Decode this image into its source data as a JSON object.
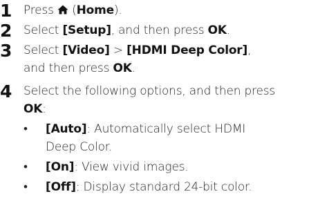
{
  "steps": [
    {
      "number": "1",
      "segments": [
        "Press ",
        " (",
        "Home",
        ")."
      ],
      "icon": "home-icon"
    },
    {
      "number": "2",
      "segments": [
        "Select ",
        "[Setup]",
        ", and then press ",
        "OK",
        "."
      ]
    },
    {
      "number": "3",
      "segments": [
        "Select ",
        "[Video]",
        " > ",
        "[HDMI Deep Color]",
        ",",
        "and then press ",
        "OK",
        "."
      ]
    },
    {
      "number": "4",
      "segments": [
        "Select the following options, and then press",
        "OK",
        ":"
      ],
      "options": [
        {
          "bullet": "•",
          "key": "[Auto]",
          "text1": ": Automatically select HDMI",
          "text2": "Deep Color."
        },
        {
          "bullet": "•",
          "key": "[On]",
          "text": ": View vivid images."
        },
        {
          "bullet": "•",
          "key": "[Off]",
          "text": ": Display standard 24-bit color."
        }
      ]
    }
  ]
}
